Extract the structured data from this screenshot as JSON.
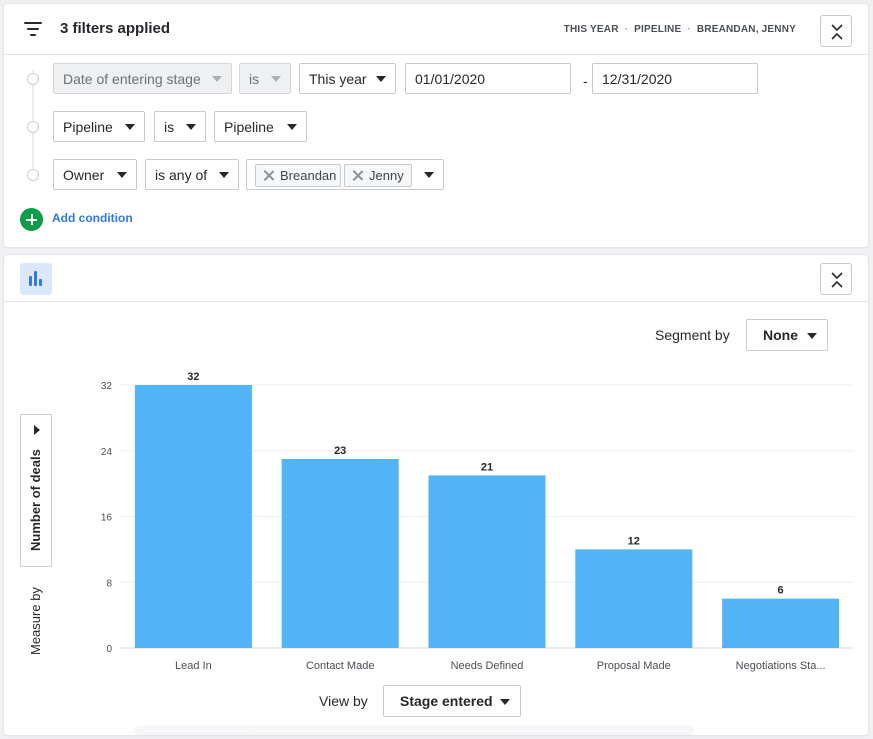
{
  "filters": {
    "title": "3 filters applied",
    "summary": [
      "THIS YEAR",
      "PIPELINE",
      "BREANDAN, JENNY"
    ],
    "conditions": [
      {
        "field": "Date of entering stage",
        "operator": "is",
        "value": "This year",
        "date_from": "01/01/2020",
        "date_to": "12/31/2020",
        "range_separator": "-"
      },
      {
        "field": "Pipeline",
        "operator": "is",
        "value": "Pipeline"
      },
      {
        "field": "Owner",
        "operator": "is any of",
        "chips": [
          "Breandan",
          "Jenny"
        ]
      }
    ],
    "add_condition_label": "Add condition"
  },
  "chart_panel": {
    "segment_by_label": "Segment by",
    "segment_by_value": "None",
    "measure_by_label": "Measure by",
    "measure_value": "Number of deals",
    "view_by_label": "View by",
    "view_by_value": "Stage entered"
  },
  "colors": {
    "bar": "#52b3f6",
    "accent": "#317ae2",
    "add": "#0b9d4a"
  },
  "chart_data": {
    "type": "bar",
    "categories": [
      "Lead In",
      "Contact Made",
      "Needs Defined",
      "Proposal Made",
      "Negotiations Sta..."
    ],
    "values": [
      32,
      23,
      21,
      12,
      6
    ],
    "yticks": [
      0,
      8,
      16,
      24,
      32
    ],
    "ylim": [
      0,
      32
    ],
    "xlabel": "Stage entered",
    "ylabel": "Number of deals",
    "grid": true
  }
}
